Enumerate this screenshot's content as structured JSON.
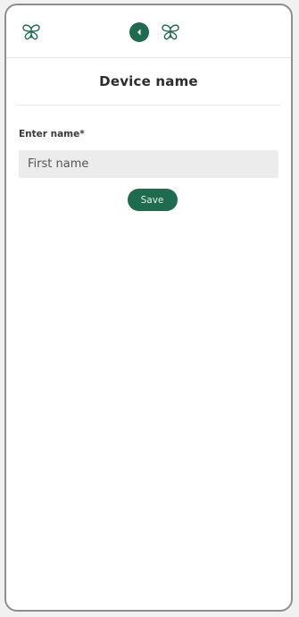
{
  "header": {
    "left_icon": "butterfly-logo-icon",
    "back_icon": "back-arrow-icon",
    "center_icon": "butterfly-logo-icon"
  },
  "page": {
    "title": "Device name"
  },
  "form": {
    "label": "Enter name*",
    "name_placeholder": "First name",
    "name_value": ""
  },
  "actions": {
    "save_label": "Save"
  },
  "colors": {
    "accent": "#1f6b4f",
    "input_bg": "#ececec",
    "icon": "#1f6b4f"
  }
}
